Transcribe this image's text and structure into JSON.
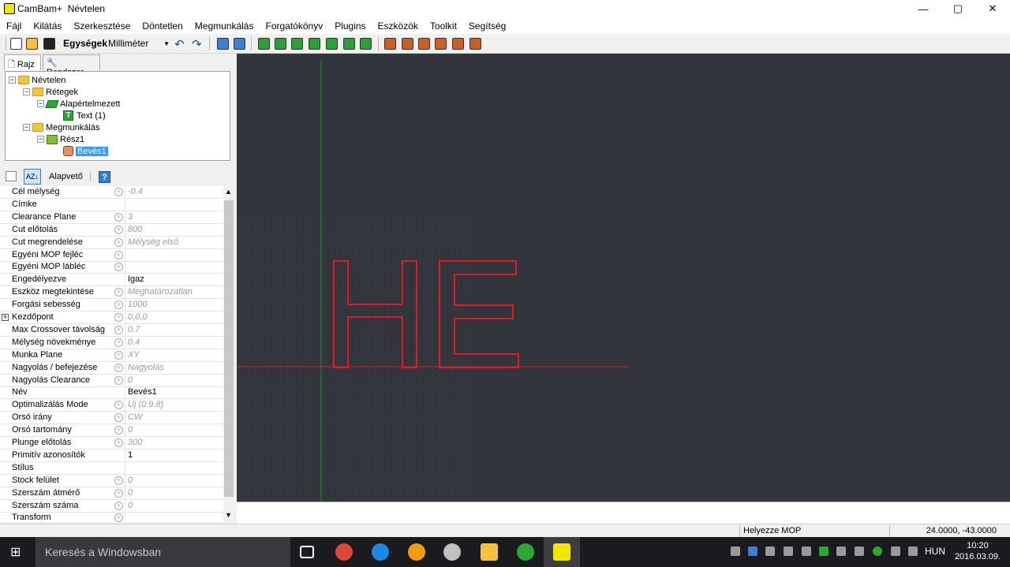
{
  "window": {
    "app_name": "CamBam+",
    "document_name": "Névtelen",
    "minimize": "—",
    "maximize": "▢",
    "close": "✕"
  },
  "menu": [
    "Fájl",
    "Kilátás",
    "Szerkesztése",
    "Döntetlen",
    "Megmunkálás",
    "Forgatókönyv",
    "Plugins",
    "Eszközök",
    "Toolkit",
    "Segítség"
  ],
  "toolbar": {
    "units_label": "Egységek",
    "units_value": "Milliméter"
  },
  "tabs": {
    "drawing": "Rajz",
    "system": "Rendszer"
  },
  "tree": {
    "root": "Névtelen",
    "layers": "Rétegek",
    "default_layer": "Alapértelmezett",
    "text_item": "Text (1)",
    "machining": "Megmunkálás",
    "part": "Rész1",
    "mop": "Bevés1"
  },
  "prop_toolbar": {
    "mode_label": "Alapvető",
    "help": "?"
  },
  "properties": [
    {
      "name": "Cél mélység",
      "value": "-0.4",
      "dim": true,
      "def": true
    },
    {
      "name": "Címke",
      "value": "",
      "dim": false,
      "def": false
    },
    {
      "name": "Clearance Plane",
      "value": "3",
      "dim": true,
      "def": true
    },
    {
      "name": "Cut előtolás",
      "value": "800",
      "dim": true,
      "def": true
    },
    {
      "name": "Cut megrendelése",
      "value": "Mélység első",
      "dim": true,
      "def": true
    },
    {
      "name": "Egyéni MOP fejléc",
      "value": "",
      "dim": true,
      "def": true
    },
    {
      "name": "Egyéni MOP lábléc",
      "value": "",
      "dim": true,
      "def": true
    },
    {
      "name": "Engedélyezve",
      "value": "Igaz",
      "dim": false,
      "def": false
    },
    {
      "name": "Eszköz megtekintése",
      "value": "Meghatározatlan",
      "dim": true,
      "def": true
    },
    {
      "name": "Forgási sebesség",
      "value": "1000",
      "dim": true,
      "def": true
    },
    {
      "name": "Kezdőpont",
      "value": "0,0,0",
      "dim": true,
      "def": true,
      "expand": "+"
    },
    {
      "name": "Max Crossover távolság",
      "value": "0.7",
      "dim": true,
      "def": true
    },
    {
      "name": "Mélység növekménye",
      "value": "0.4",
      "dim": true,
      "def": true
    },
    {
      "name": "Munka Plane",
      "value": "XY",
      "dim": true,
      "def": true
    },
    {
      "name": "Nagyolás / befejezése",
      "value": "Nagyolás",
      "dim": true,
      "def": true
    },
    {
      "name": "Nagyolás Clearance",
      "value": "0",
      "dim": true,
      "def": true
    },
    {
      "name": "Név",
      "value": "Bevés1",
      "dim": false,
      "def": false
    },
    {
      "name": "Optimalizálás Mode",
      "value": "Új (0.9.8)",
      "dim": true,
      "def": true
    },
    {
      "name": "Orsó irány",
      "value": "CW",
      "dim": true,
      "def": true
    },
    {
      "name": "Orsó tartomány",
      "value": "0",
      "dim": true,
      "def": true
    },
    {
      "name": "Plunge előtolás",
      "value": "300",
      "dim": true,
      "def": true
    },
    {
      "name": "Primitív azonosítók",
      "value": "1",
      "dim": false,
      "def": false
    },
    {
      "name": "Stílus",
      "value": "",
      "dim": false,
      "def": false
    },
    {
      "name": "Stock felület",
      "value": "0",
      "dim": true,
      "def": true
    },
    {
      "name": "Szerszám átmérő",
      "value": "0",
      "dim": true,
      "def": true
    },
    {
      "name": "Szerszám száma",
      "value": "0",
      "dim": true,
      "def": true
    },
    {
      "name": "Transform",
      "value": "",
      "dim": true,
      "def": true
    }
  ],
  "canvas_text": "HE",
  "status": {
    "hint": "Helyezze MOP",
    "coords": "24.0000, -43.0000"
  },
  "taskbar": {
    "search_placeholder": "Keresés a Windowsban",
    "language": "HUN",
    "time": "10:20",
    "date": "2016.03.09."
  },
  "colors": {
    "canvas_bg": "#33353c",
    "geometry": "#e01b24",
    "y_axis": "#1f8f2a",
    "selection": "#3399ff"
  }
}
